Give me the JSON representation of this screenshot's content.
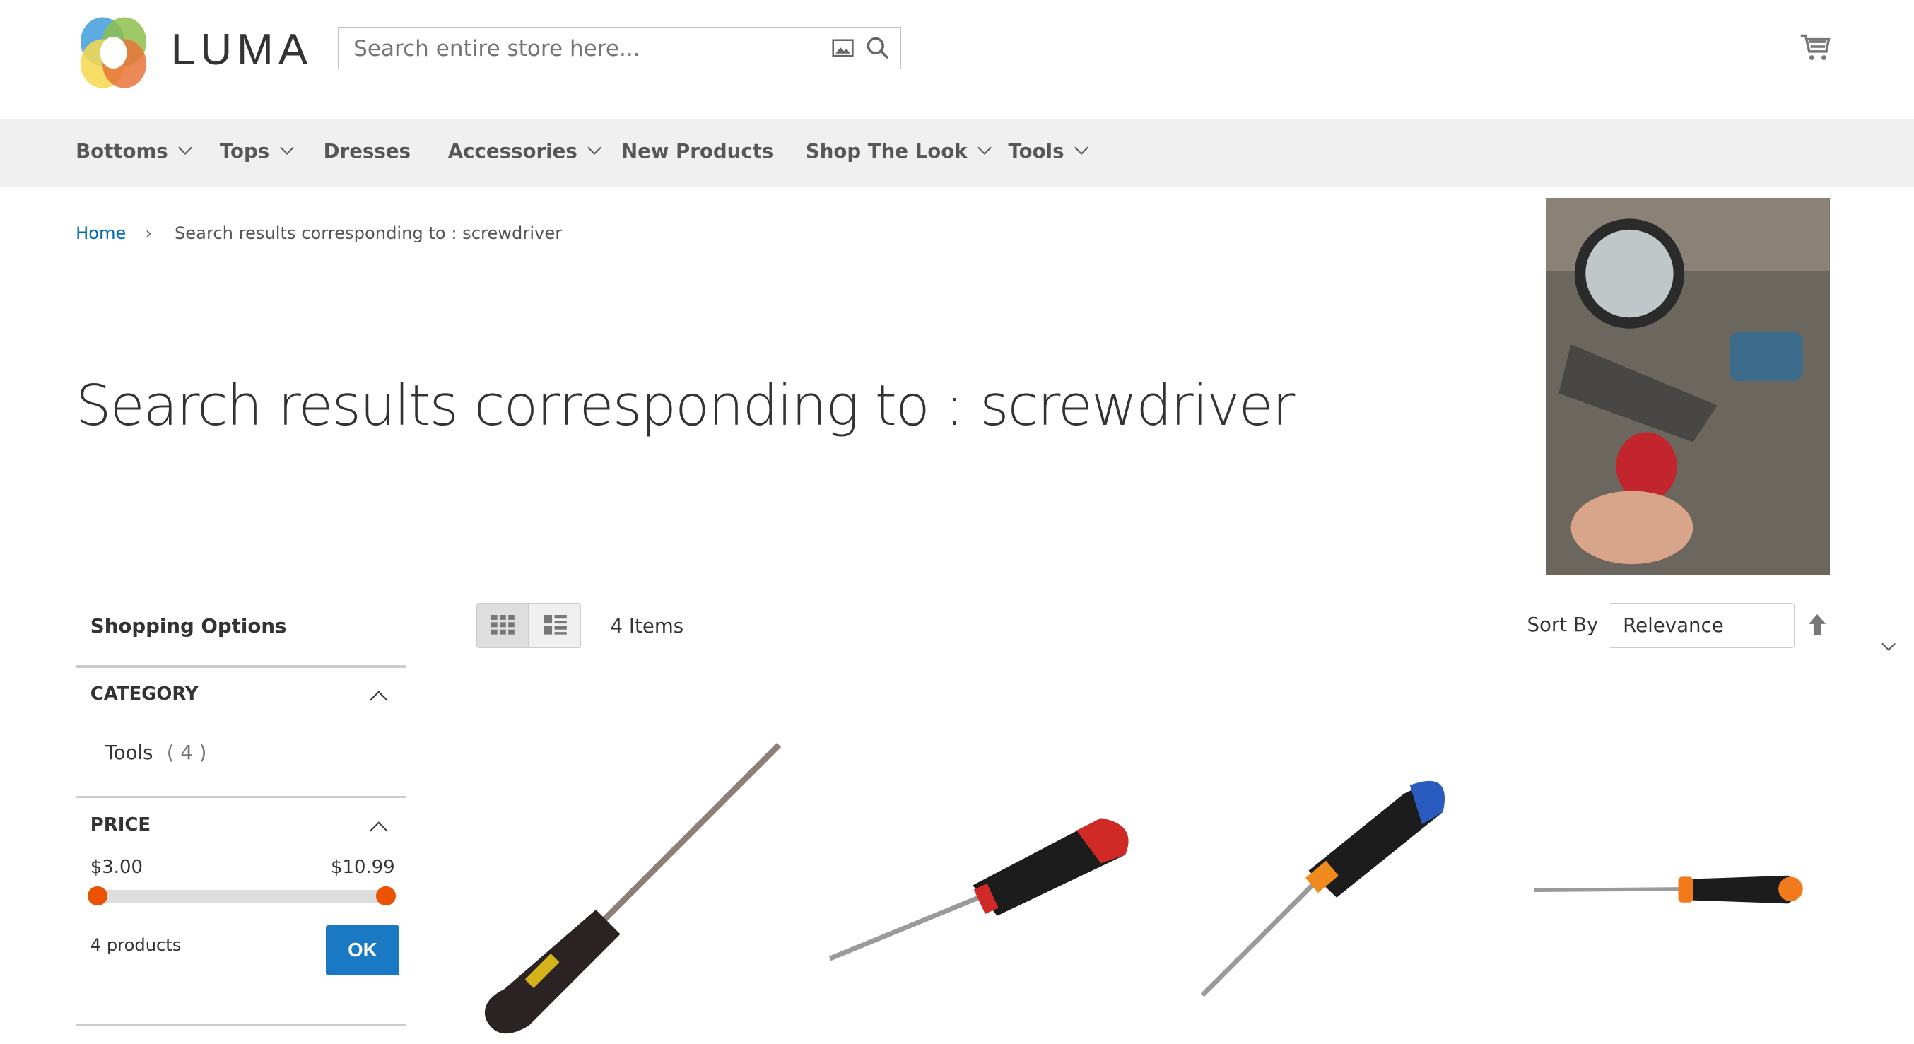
{
  "header": {
    "logo_text": "LUMA",
    "search_placeholder": "Search entire store here...",
    "icons": [
      "image-search-icon",
      "search-icon",
      "cart-icon"
    ]
  },
  "nav": {
    "items": [
      {
        "label": "Bottoms",
        "dropdown": true
      },
      {
        "label": "Tops",
        "dropdown": true
      },
      {
        "label": "Dresses",
        "dropdown": false
      },
      {
        "label": "Accessories",
        "dropdown": true
      },
      {
        "label": "New Products",
        "dropdown": false
      },
      {
        "label": "Shop The Look",
        "dropdown": true
      },
      {
        "label": "Tools",
        "dropdown": true
      }
    ]
  },
  "breadcrumb": {
    "home": "Home",
    "current": "Search results corresponding to : screwdriver"
  },
  "page_title": "Search results corresponding to : screwdriver",
  "sidebar": {
    "title": "Shopping Options",
    "category": {
      "heading": "CATEGORY",
      "items": [
        {
          "label": "Tools",
          "count": "( 4 )"
        }
      ]
    },
    "price": {
      "heading": "PRICE",
      "min": "$3.00",
      "max": "$10.99",
      "range_low_fraction": 0,
      "range_high_fraction": 1,
      "count": "4 products",
      "ok": "OK"
    }
  },
  "toolbar": {
    "items_count": "4 Items",
    "sort_label": "Sort By",
    "sort_value": "Relevance",
    "view_mode": "grid"
  },
  "colors": {
    "link": "#006bb4",
    "button": "#1979c3",
    "slider": "#eb5202",
    "nav_bg": "#f0f0f0"
  }
}
